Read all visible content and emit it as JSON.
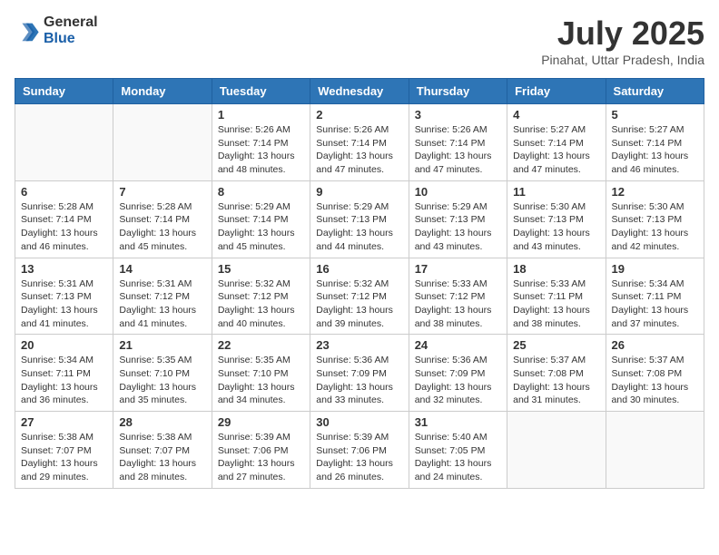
{
  "header": {
    "logo_general": "General",
    "logo_blue": "Blue",
    "month_year": "July 2025",
    "location": "Pinahat, Uttar Pradesh, India"
  },
  "days_of_week": [
    "Sunday",
    "Monday",
    "Tuesday",
    "Wednesday",
    "Thursday",
    "Friday",
    "Saturday"
  ],
  "weeks": [
    [
      {
        "day": "",
        "info": ""
      },
      {
        "day": "",
        "info": ""
      },
      {
        "day": "1",
        "info": "Sunrise: 5:26 AM\nSunset: 7:14 PM\nDaylight: 13 hours and 48 minutes."
      },
      {
        "day": "2",
        "info": "Sunrise: 5:26 AM\nSunset: 7:14 PM\nDaylight: 13 hours and 47 minutes."
      },
      {
        "day": "3",
        "info": "Sunrise: 5:26 AM\nSunset: 7:14 PM\nDaylight: 13 hours and 47 minutes."
      },
      {
        "day": "4",
        "info": "Sunrise: 5:27 AM\nSunset: 7:14 PM\nDaylight: 13 hours and 47 minutes."
      },
      {
        "day": "5",
        "info": "Sunrise: 5:27 AM\nSunset: 7:14 PM\nDaylight: 13 hours and 46 minutes."
      }
    ],
    [
      {
        "day": "6",
        "info": "Sunrise: 5:28 AM\nSunset: 7:14 PM\nDaylight: 13 hours and 46 minutes."
      },
      {
        "day": "7",
        "info": "Sunrise: 5:28 AM\nSunset: 7:14 PM\nDaylight: 13 hours and 45 minutes."
      },
      {
        "day": "8",
        "info": "Sunrise: 5:29 AM\nSunset: 7:14 PM\nDaylight: 13 hours and 45 minutes."
      },
      {
        "day": "9",
        "info": "Sunrise: 5:29 AM\nSunset: 7:13 PM\nDaylight: 13 hours and 44 minutes."
      },
      {
        "day": "10",
        "info": "Sunrise: 5:29 AM\nSunset: 7:13 PM\nDaylight: 13 hours and 43 minutes."
      },
      {
        "day": "11",
        "info": "Sunrise: 5:30 AM\nSunset: 7:13 PM\nDaylight: 13 hours and 43 minutes."
      },
      {
        "day": "12",
        "info": "Sunrise: 5:30 AM\nSunset: 7:13 PM\nDaylight: 13 hours and 42 minutes."
      }
    ],
    [
      {
        "day": "13",
        "info": "Sunrise: 5:31 AM\nSunset: 7:13 PM\nDaylight: 13 hours and 41 minutes."
      },
      {
        "day": "14",
        "info": "Sunrise: 5:31 AM\nSunset: 7:12 PM\nDaylight: 13 hours and 41 minutes."
      },
      {
        "day": "15",
        "info": "Sunrise: 5:32 AM\nSunset: 7:12 PM\nDaylight: 13 hours and 40 minutes."
      },
      {
        "day": "16",
        "info": "Sunrise: 5:32 AM\nSunset: 7:12 PM\nDaylight: 13 hours and 39 minutes."
      },
      {
        "day": "17",
        "info": "Sunrise: 5:33 AM\nSunset: 7:12 PM\nDaylight: 13 hours and 38 minutes."
      },
      {
        "day": "18",
        "info": "Sunrise: 5:33 AM\nSunset: 7:11 PM\nDaylight: 13 hours and 38 minutes."
      },
      {
        "day": "19",
        "info": "Sunrise: 5:34 AM\nSunset: 7:11 PM\nDaylight: 13 hours and 37 minutes."
      }
    ],
    [
      {
        "day": "20",
        "info": "Sunrise: 5:34 AM\nSunset: 7:11 PM\nDaylight: 13 hours and 36 minutes."
      },
      {
        "day": "21",
        "info": "Sunrise: 5:35 AM\nSunset: 7:10 PM\nDaylight: 13 hours and 35 minutes."
      },
      {
        "day": "22",
        "info": "Sunrise: 5:35 AM\nSunset: 7:10 PM\nDaylight: 13 hours and 34 minutes."
      },
      {
        "day": "23",
        "info": "Sunrise: 5:36 AM\nSunset: 7:09 PM\nDaylight: 13 hours and 33 minutes."
      },
      {
        "day": "24",
        "info": "Sunrise: 5:36 AM\nSunset: 7:09 PM\nDaylight: 13 hours and 32 minutes."
      },
      {
        "day": "25",
        "info": "Sunrise: 5:37 AM\nSunset: 7:08 PM\nDaylight: 13 hours and 31 minutes."
      },
      {
        "day": "26",
        "info": "Sunrise: 5:37 AM\nSunset: 7:08 PM\nDaylight: 13 hours and 30 minutes."
      }
    ],
    [
      {
        "day": "27",
        "info": "Sunrise: 5:38 AM\nSunset: 7:07 PM\nDaylight: 13 hours and 29 minutes."
      },
      {
        "day": "28",
        "info": "Sunrise: 5:38 AM\nSunset: 7:07 PM\nDaylight: 13 hours and 28 minutes."
      },
      {
        "day": "29",
        "info": "Sunrise: 5:39 AM\nSunset: 7:06 PM\nDaylight: 13 hours and 27 minutes."
      },
      {
        "day": "30",
        "info": "Sunrise: 5:39 AM\nSunset: 7:06 PM\nDaylight: 13 hours and 26 minutes."
      },
      {
        "day": "31",
        "info": "Sunrise: 5:40 AM\nSunset: 7:05 PM\nDaylight: 13 hours and 24 minutes."
      },
      {
        "day": "",
        "info": ""
      },
      {
        "day": "",
        "info": ""
      }
    ]
  ]
}
